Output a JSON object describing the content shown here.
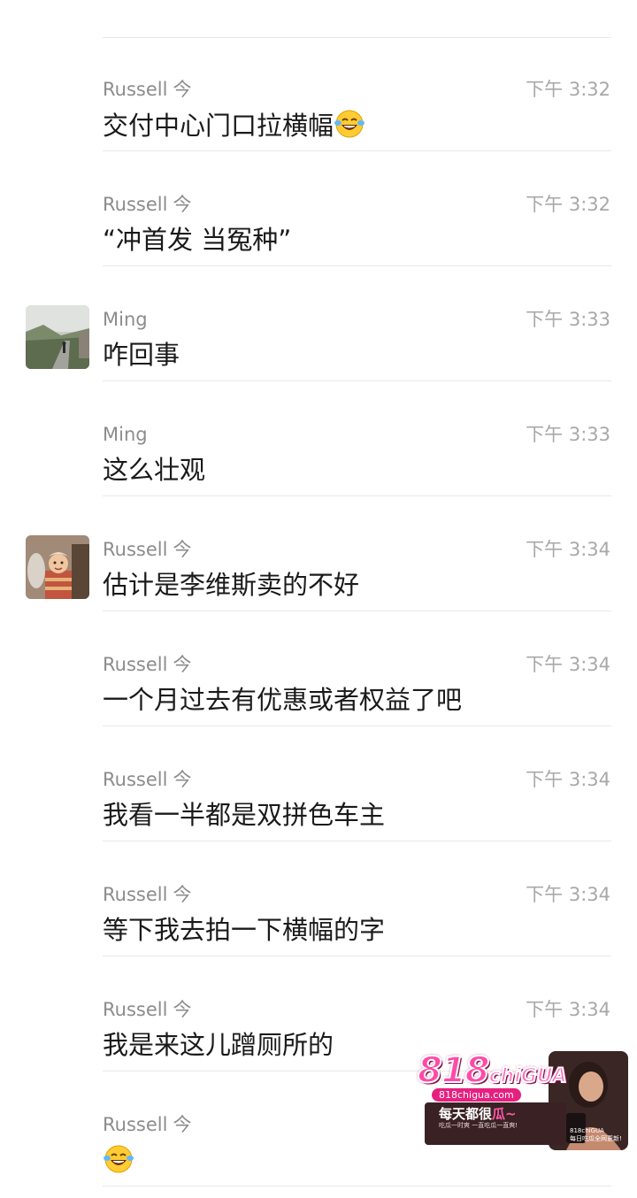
{
  "messages": [
    {
      "sender": "Russell",
      "suffix": "今",
      "time": "下午 3:32",
      "text": "交付中心门口拉横幅",
      "emoji": "laughing-tears-icon",
      "avatar": null
    },
    {
      "sender": "Russell",
      "suffix": "今",
      "time": "下午 3:32",
      "text": "“冲首发 当冤种”",
      "emoji": null,
      "avatar": null
    },
    {
      "sender": "Ming",
      "suffix": "",
      "time": "下午 3:33",
      "text": "咋回事",
      "emoji": null,
      "avatar": "mountain-road-photo"
    },
    {
      "sender": "Ming",
      "suffix": "",
      "time": "下午 3:33",
      "text": "这么壮观",
      "emoji": null,
      "avatar": null
    },
    {
      "sender": "Russell",
      "suffix": "今",
      "time": "下午 3:34",
      "text": "估计是李维斯卖的不好",
      "emoji": null,
      "avatar": "child-photo"
    },
    {
      "sender": "Russell",
      "suffix": "今",
      "time": "下午 3:34",
      "text": "一个月过去有优惠或者权益了吧",
      "emoji": null,
      "avatar": null
    },
    {
      "sender": "Russell",
      "suffix": "今",
      "time": "下午 3:34",
      "text": "我看一半都是双拼色车主",
      "emoji": null,
      "avatar": null
    },
    {
      "sender": "Russell",
      "suffix": "今",
      "time": "下午 3:34",
      "text": "等下我去拍一下横幅的字",
      "emoji": null,
      "avatar": null
    },
    {
      "sender": "Russell",
      "suffix": "今",
      "time": "下午 3:34",
      "text": "我是来这儿蹭厕所的",
      "emoji": null,
      "avatar": null
    },
    {
      "sender": "Russell",
      "suffix": "今",
      "time": "",
      "text": "",
      "emoji": "laughing-tears-icon",
      "avatar": null
    }
  ],
  "watermark": {
    "logo_num": "818",
    "logo_word": "chiGUA",
    "site": "818chigua.com",
    "slogan_a": "每天都很",
    "slogan_b": "瓜~",
    "sub": "吃瓜一时爽 一直吃瓜一直爽!",
    "side_a": "818chiGUA",
    "side_b": "每日吃瓜全网更新!"
  },
  "colors": {
    "sender": "#8c8c8c",
    "time": "#a8a8a8",
    "text": "#1a1a1a",
    "divider": "#e8e8e8",
    "watermark_pink": "#ff4aa8"
  }
}
